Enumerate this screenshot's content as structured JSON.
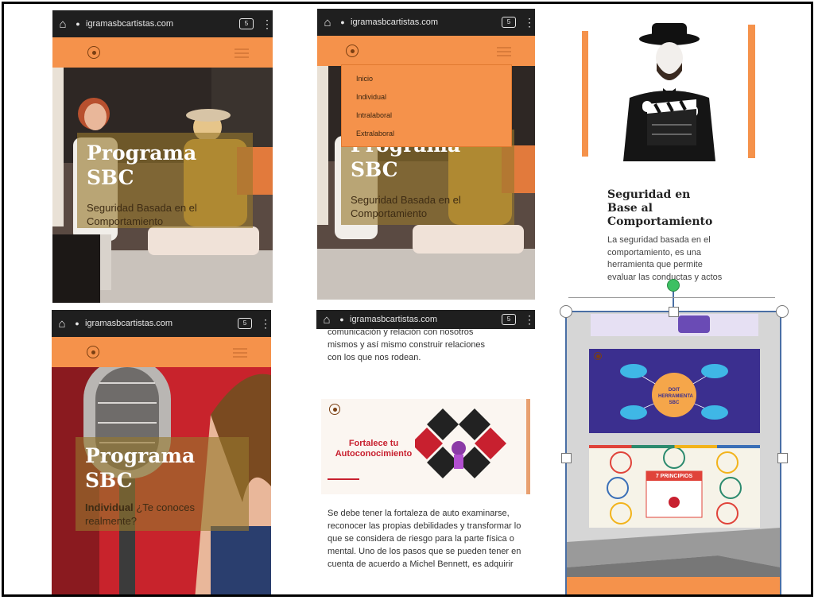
{
  "browser": {
    "url": "igramasbcartistas.com",
    "tab_count": "5"
  },
  "shot1": {
    "title_line1": "Programa",
    "title_line2": "SBC",
    "subtitle": "Seguridad Basada en el Comportamiento"
  },
  "shot2": {
    "menu": [
      "Inicio",
      "Individual",
      "Intralaboral",
      "Extralaboral"
    ],
    "title_line1": "Programa",
    "title_line2": "SBC",
    "subtitle": "Seguridad Basada en el Comportamiento"
  },
  "shot3": {
    "heading": "Seguridad en Base al Comportamiento",
    "body": "La seguridad basada en el comportamiento, es una herramienta que permite evaluar las conductas y actos"
  },
  "shot4": {
    "title_line1": "Programa",
    "title_line2": "SBC",
    "subtitle_bold": "Individual",
    "subtitle_rest": " ¿Te conoces realmente?"
  },
  "shot5": {
    "intro": "comunicación y relación con nosotros mismos y así mismo construir relaciones con los que nos rodean.",
    "banner_title": "Fortalece tu Autoconocimiento",
    "body": "Se debe tener la fortaleza de auto examinarse, reconocer las propias debilidades y transformar lo que se considera de riesgo para la parte física o mental. Uno de los pasos que se pueden tener en cuenta de acuerdo a Michel Bennett, es adquirir"
  },
  "shot6": {
    "card1_center": "DOIT HERRAMIENTA SBC",
    "card2_banner": "7 PRINCIPIOS"
  },
  "colors": {
    "header_orange": "#f5924b",
    "overlay": "#96782d",
    "card_purple": "#3b2f8f",
    "diamond_red": "#c8202f",
    "selection_blue": "#4a6fa5",
    "handle_green": "#3cc063"
  }
}
